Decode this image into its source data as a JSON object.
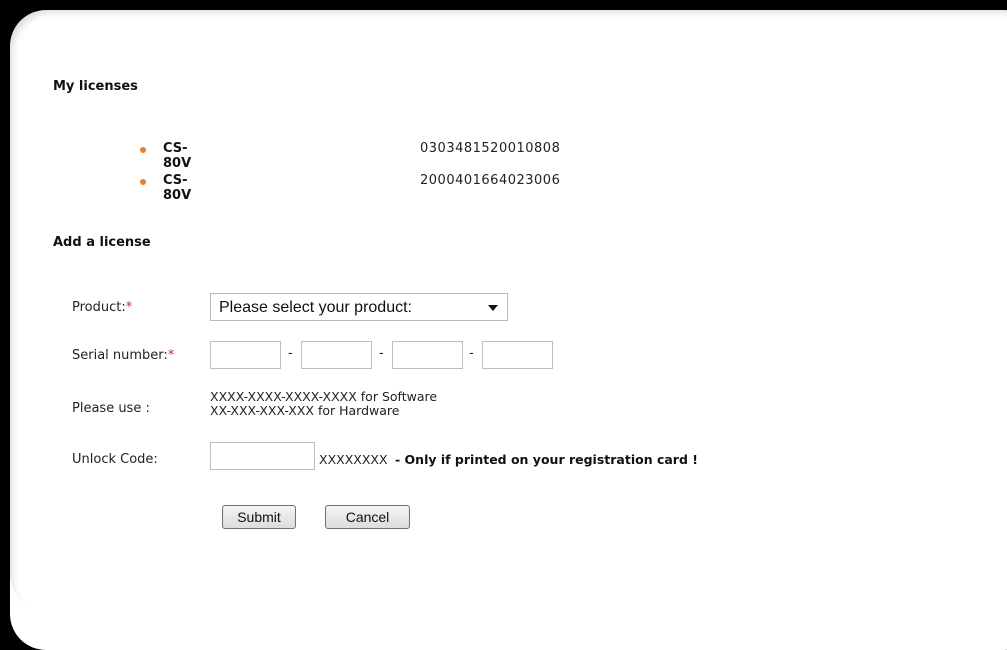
{
  "my_licenses": {
    "title": "My licenses",
    "items": [
      {
        "product": "CS-80V",
        "serial": "0303481520010808"
      },
      {
        "product": "CS-80V",
        "serial": "2000401664023006"
      }
    ]
  },
  "add_license": {
    "title": "Add a license",
    "product_label": "Product:",
    "required_mark": "*",
    "product_select_value": "Please select your product:",
    "serial_label": "Serial number:",
    "serial_separator": "-",
    "please_use_label": "Please use :",
    "format_software": "XXXX-XXXX-XXXX-XXXX for Software",
    "format_hardware": "XX-XXX-XXX-XXX for Hardware",
    "unlock_label": "Unlock Code:",
    "unlock_mask": "XXXXXXXX",
    "unlock_note": "- Only if printed on your registration card !",
    "submit_label": "Submit",
    "cancel_label": "Cancel"
  },
  "colors": {
    "bullet": "#ef7d22",
    "required": "#dd2222",
    "frame": "#000000"
  }
}
